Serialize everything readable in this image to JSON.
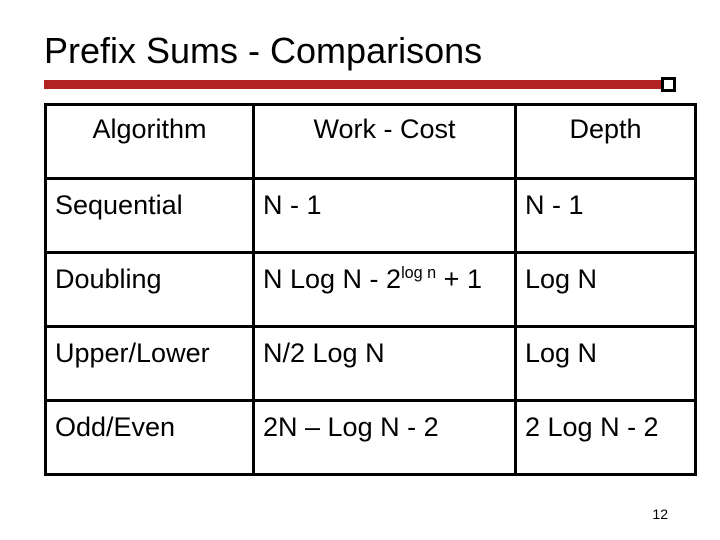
{
  "title": "Prefix Sums - Comparisons",
  "headers": {
    "c1": "Algorithm",
    "c2": "Work - Cost",
    "c3": "Depth"
  },
  "rows": [
    {
      "algo": "Sequential",
      "work": "N - 1",
      "depth": "N - 1"
    },
    {
      "algo": "Doubling",
      "work_html": "N Log N - 2<sup>log n</sup> + 1",
      "depth": "Log N"
    },
    {
      "algo": "Upper/Lower",
      "work": "N/2 Log N",
      "depth": "Log N"
    },
    {
      "algo": "Odd/Even",
      "work": "2N – Log N - 2",
      "depth": "2 Log N - 2"
    }
  ],
  "page_number": "12"
}
